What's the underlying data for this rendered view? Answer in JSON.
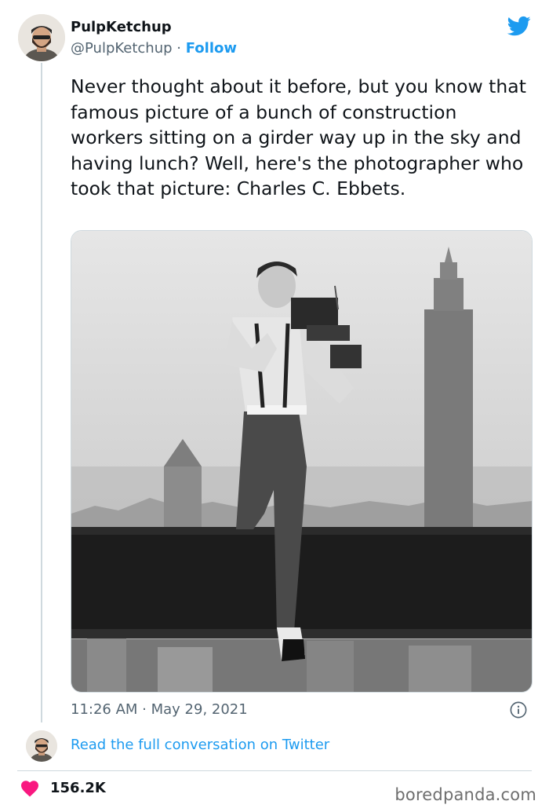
{
  "author": {
    "name": "PulpKetchup",
    "handle": "@PulpKetchup",
    "separator": " · ",
    "follow_label": "Follow"
  },
  "tweet": {
    "text": "Never thought about it before, but you know that famous picture of a bunch of construction workers sitting on a girder way up in the sky and having lunch? Well, here's the photographer who took that picture: Charles C. Ebbets.",
    "timestamp": "11:26 AM · May 29, 2021"
  },
  "conversation": {
    "link_label": "Read the full conversation on Twitter"
  },
  "engagement": {
    "likes": "156.2K"
  },
  "watermark": "boredpanda.com",
  "colors": {
    "accent": "#1d9bf0",
    "heart": "#f91880",
    "text": "#0f1419",
    "muted": "#536471"
  },
  "icons": [
    "twitter-bird-icon",
    "info-icon",
    "heart-icon"
  ]
}
